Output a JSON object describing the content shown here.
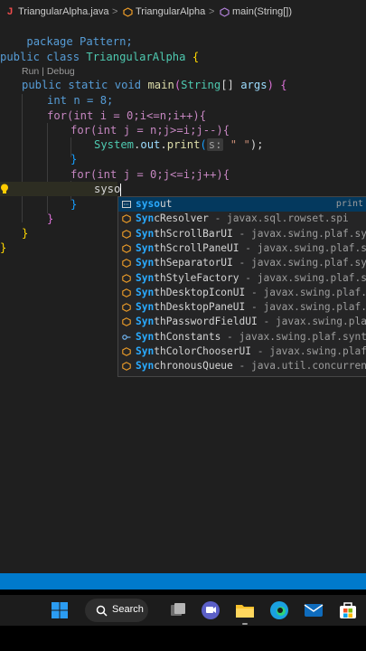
{
  "breadcrumb": {
    "file_icon": "J",
    "file": "TriangularAlpha.java",
    "sep": ">",
    "class_name": "TriangularAlpha",
    "method": "main(String[])"
  },
  "code": {
    "line1": "package Pattern;",
    "line2_kw1": "public",
    "line2_kw2": "class",
    "line2_name": "TriangularAlpha",
    "line2_brace": "{",
    "codelens": "Run | Debug",
    "line3_kw1": "public",
    "line3_kw2": "static",
    "line3_kw3": "void",
    "line3_name": "main",
    "line3_type": "String",
    "line3_arr": "[]",
    "line3_arg": "args",
    "line4": "int n = 8;",
    "line5": "for(int i = 0;i<=n;i++){",
    "line6": "for(int j = n;j>=i;j--){",
    "line7_obj": "System",
    "line7_out": "out",
    "line7_fn": "print",
    "line7_hint": "s:",
    "line7_str": "\" \"",
    "line7_end": ");",
    "line8": "}",
    "line9": "for(int j = 0;j<=i;j++){",
    "line10": "syso",
    "close1": "}",
    "close2": "}",
    "close3": "}"
  },
  "suggestions": [
    {
      "match": "syso",
      "rest": "ut",
      "detail": "",
      "right": "print",
      "selected": true,
      "kind": "snippet"
    },
    {
      "match": "Syn",
      "rest": "cResolver",
      "detail": " - javax.sql.rowset.spi",
      "right": "",
      "selected": false,
      "kind": "class"
    },
    {
      "match": "Syn",
      "rest": "thScrollBarUI",
      "detail": " - javax.swing.plaf.syn",
      "right": "",
      "selected": false,
      "kind": "class"
    },
    {
      "match": "Syn",
      "rest": "thScrollPaneUI",
      "detail": " - javax.swing.plaf.sy",
      "right": "",
      "selected": false,
      "kind": "class"
    },
    {
      "match": "Syn",
      "rest": "thSeparatorUI",
      "detail": " - javax.swing.plaf.sy",
      "right": "",
      "selected": false,
      "kind": "class"
    },
    {
      "match": "Syn",
      "rest": "thStyleFactory",
      "detail": " - javax.swing.plaf.sy",
      "right": "",
      "selected": false,
      "kind": "class"
    },
    {
      "match": "Syn",
      "rest": "thDesktopIconUI",
      "detail": " - javax.swing.plaf.s",
      "right": "",
      "selected": false,
      "kind": "class"
    },
    {
      "match": "Syn",
      "rest": "thDesktopPaneUI",
      "detail": " - javax.swing.plaf.s",
      "right": "",
      "selected": false,
      "kind": "class"
    },
    {
      "match": "Syn",
      "rest": "thPasswordFieldUI",
      "detail": " - javax.swing.plaf",
      "right": "",
      "selected": false,
      "kind": "class"
    },
    {
      "match": "Syn",
      "rest": "thConstants",
      "detail": " - javax.swing.plaf.synth",
      "right": "",
      "selected": false,
      "kind": "interface"
    },
    {
      "match": "Syn",
      "rest": "thColorChooserUI",
      "detail": " - javax.swing.plaf",
      "right": "",
      "selected": false,
      "kind": "class"
    },
    {
      "match": "Syn",
      "rest": "chronousQueue",
      "detail": " - java.util.concurrent",
      "right": "",
      "selected": false,
      "kind": "class"
    }
  ],
  "taskbar": {
    "search_label": "Search",
    "apps": [
      "start-icon",
      "search-icon",
      "task-view-icon",
      "teams-icon",
      "file-explorer-icon",
      "edge-icon",
      "mail-icon",
      "store-icon"
    ]
  },
  "colors": {
    "editor_bg": "#1f1f1f",
    "status_bar": "#007acc",
    "selection": "#04395e",
    "match": "#2aaaff"
  }
}
